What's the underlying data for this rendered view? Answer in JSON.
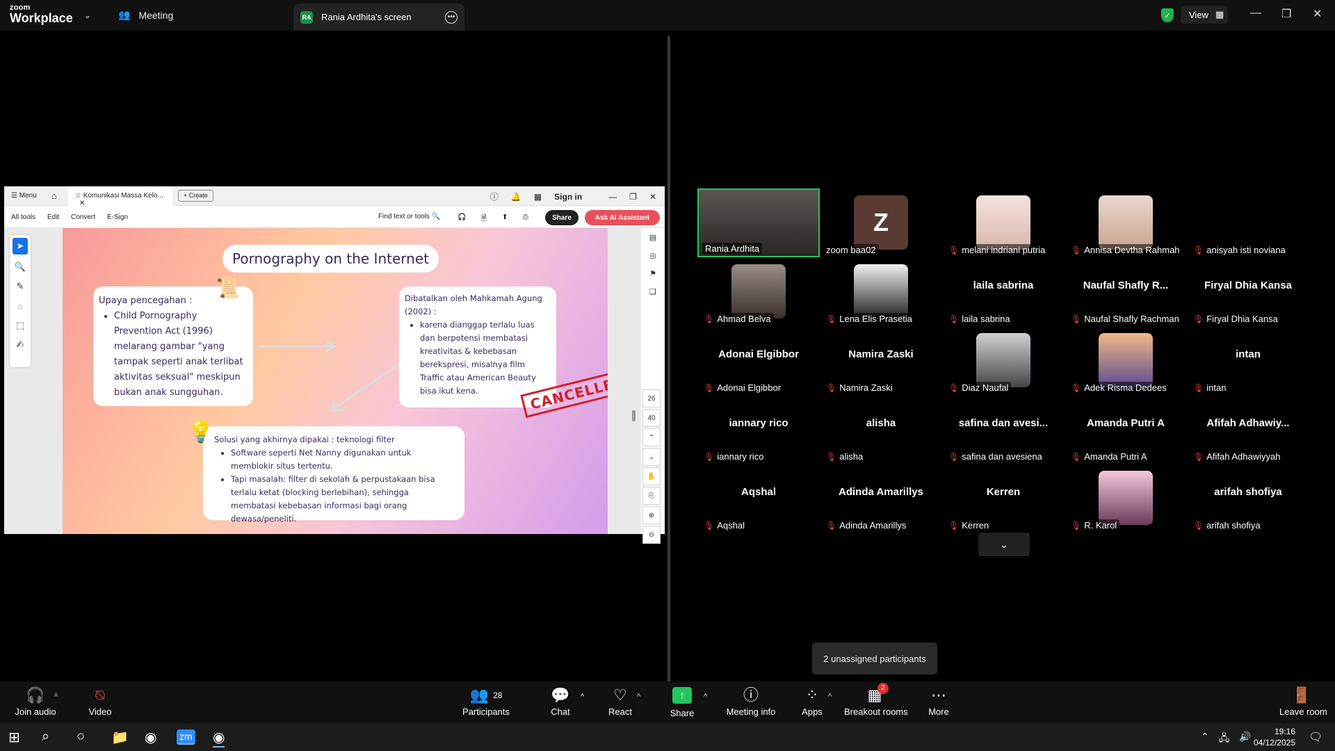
{
  "zoom": {
    "logo_line1": "zoom",
    "logo_line2": "Workplace",
    "meeting_label": "Meeting",
    "tab_badge": "RA",
    "tab_title": "Rania Ardhita's screen",
    "view_label": "View"
  },
  "acrobat": {
    "menu": "Menu",
    "doc_tab": "Komunikasi Massa Kelo...",
    "create": "Create",
    "sign_in": "Sign in",
    "tools": [
      "All tools",
      "Edit",
      "Convert",
      "E-Sign"
    ],
    "find": "Find text or tools",
    "share": "Share",
    "ai": "Ask AI Assistant",
    "pages": [
      "26",
      "40"
    ]
  },
  "slide": {
    "title": "Pornography on the Internet",
    "c1_head": "Upaya pencegahan :",
    "c1_items": [
      "Child Pornography Prevention Act (1996) melarang gambar \"yang tampak seperti anak terlibat aktivitas seksual\" meskipun bukan anak sungguhan."
    ],
    "c2_head": "Dibatalkan oleh Mahkamah Agung (2002) :",
    "c2_items": [
      "karena dianggap terlalu luas dan berpotensi membatasi kreativitas & kebebasan berekspresi, misalnya film Traffic atau American Beauty bisa ikut kena."
    ],
    "stamp": "CANCELLED",
    "c3_head": "Solusi yang akhirnya dipakai : teknologi filter",
    "c3_items": [
      "Software seperti Net Nanny digunakan untuk memblokir situs tertentu.",
      "Tapi masalah: filter di sekolah & perpustakaan bisa terlalu ketat (blocking berlebihan), sehingga membatasi kebebasan informasi bagi orang dewasa/peneliti."
    ]
  },
  "gallery": {
    "participants": [
      {
        "label": "Rania Ardhita",
        "big": "",
        "muted": false
      },
      {
        "label": "zoom baa02",
        "big": "",
        "muted": false
      },
      {
        "label": "melani indriani putria",
        "big": "",
        "muted": true
      },
      {
        "label": "Annisa Devtha Rahmah",
        "big": "",
        "muted": true
      },
      {
        "label": "anisyah isti noviana",
        "big": "",
        "muted": true
      },
      {
        "label": "Ahmad Belva",
        "big": "",
        "muted": true
      },
      {
        "label": "Lena Elis Prasetia",
        "big": "",
        "muted": true
      },
      {
        "label": "laila sabrina",
        "big": "laila sabrina",
        "muted": true
      },
      {
        "label": "Naufal Shafly Rachman",
        "big": "Naufal Shafly R...",
        "muted": true
      },
      {
        "label": "Firyal Dhia Kansa",
        "big": "Firyal Dhia Kansa",
        "muted": true
      },
      {
        "label": "Adonai Elgibbor",
        "big": "Adonai Elgibbor",
        "muted": true
      },
      {
        "label": "Namira Zaski",
        "big": "Namira Zaski",
        "muted": true
      },
      {
        "label": "Diaz Naufal",
        "big": "",
        "muted": true
      },
      {
        "label": "Adek Risma Dedees",
        "big": "",
        "muted": true
      },
      {
        "label": "intan",
        "big": "intan",
        "muted": true
      },
      {
        "label": "iannary rico",
        "big": "iannary rico",
        "muted": true
      },
      {
        "label": "alisha",
        "big": "alisha",
        "muted": true
      },
      {
        "label": "safina dan avesiena",
        "big": "safina dan avesi...",
        "muted": true
      },
      {
        "label": "Amanda Putri A",
        "big": "Amanda Putri A",
        "muted": true
      },
      {
        "label": "Afifah Adhawiyyah",
        "big": "Afifah Adhawiy...",
        "muted": true
      },
      {
        "label": "Aqshal",
        "big": "Aqshal",
        "muted": true
      },
      {
        "label": "Adinda Amarillys",
        "big": "Adinda Amarillys",
        "muted": true
      },
      {
        "label": "Kerren",
        "big": "Kerren",
        "muted": true
      },
      {
        "label": "R. Karol",
        "big": "",
        "muted": true
      },
      {
        "label": "arifah shofiya",
        "big": "arifah shofiya",
        "muted": true
      }
    ],
    "z_letter": "Z",
    "tooltip": "2 unassigned participants"
  },
  "toolbar": {
    "join_audio": "Join audio",
    "video": "Video",
    "participants": "Participants",
    "participants_count": "28",
    "chat": "Chat",
    "react": "React",
    "share": "Share",
    "meeting_info": "Meeting info",
    "apps": "Apps",
    "breakout": "Breakout rooms",
    "breakout_badge": "2",
    "more": "More",
    "leave": "Leave room"
  },
  "taskbar": {
    "time": "19:16",
    "date": "04/12/2025"
  },
  "colors": {
    "accent_green": "#22c55e",
    "mute_red": "#e0463c",
    "share_bg": "#e8505b"
  }
}
